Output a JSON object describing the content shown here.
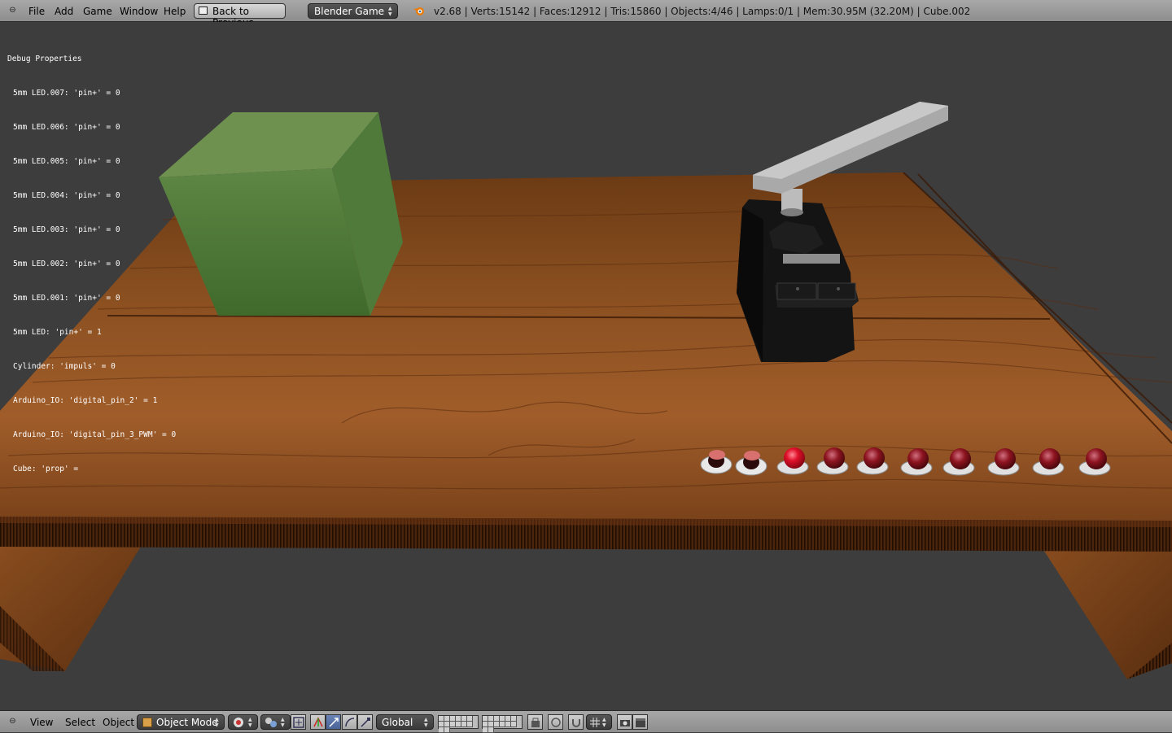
{
  "top_header": {
    "menus": [
      "File",
      "Add",
      "Game",
      "Window",
      "Help"
    ],
    "back_button": "Back to Previous",
    "engine": "Blender Game",
    "stats": "v2.68 | Verts:15142 | Faces:12912 | Tris:15860 | Objects:4/46 | Lamps:0/1 | Mem:30.95M (32.20M) | Cube.002"
  },
  "debug": {
    "title": "Debug Properties",
    "lines": [
      "5mm LED.007: 'pin+' = 0",
      "5mm LED.006: 'pin+' = 0",
      "5mm LED.005: 'pin+' = 0",
      "5mm LED.004: 'pin+' = 0",
      "5mm LED.003: 'pin+' = 0",
      "5mm LED.002: 'pin+' = 0",
      "5mm LED.001: 'pin+' = 0",
      "5mm LED: 'pin+' = 1",
      "Cylinder: 'impuls' = 0",
      "Arduino_IO: 'digital_pin_2' = 1",
      "Arduino_IO: 'digital_pin_3_PWM' = 0",
      "Cube: 'prop' ="
    ]
  },
  "bottom_header": {
    "menus": [
      "View",
      "Select",
      "Object"
    ],
    "mode": "Object Mode",
    "orientation": "Global"
  },
  "scene_colors": {
    "background": "#3d3d3d",
    "wood": "#8a4d1f",
    "cube": "#5e8644",
    "servo": "#151515",
    "arm": "#a9a9a9",
    "led_lit": "#e0102a",
    "led_dim": "#8e1420",
    "led_button": "#d87070"
  }
}
